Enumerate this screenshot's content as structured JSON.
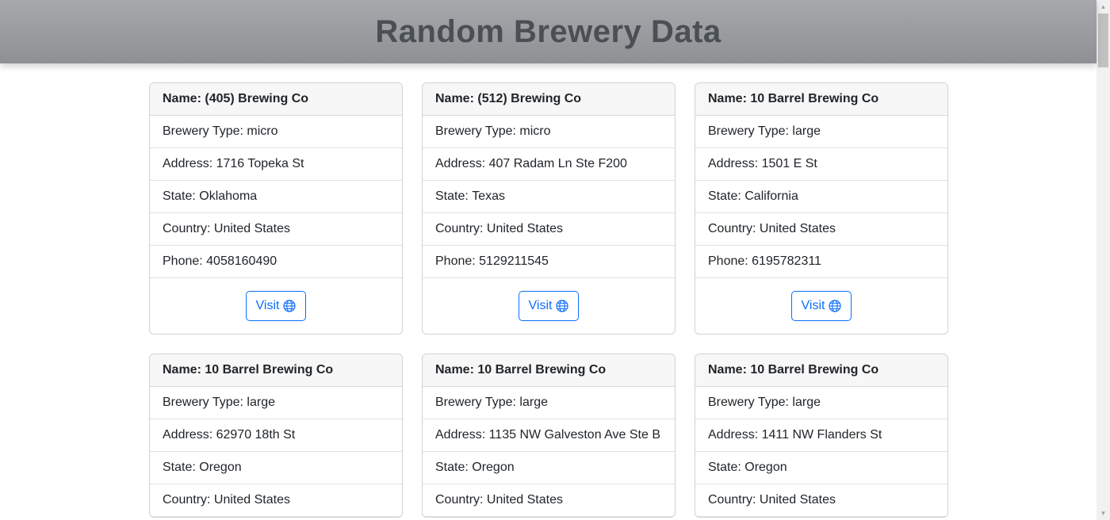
{
  "page": {
    "title": "Random Brewery Data"
  },
  "labels": {
    "name": "Name: ",
    "type": "Brewery Type: ",
    "address": "Address: ",
    "state": "State: ",
    "country": "Country: ",
    "phone": "Phone: ",
    "visit": "Visit"
  },
  "icons": {
    "visit": "globe-icon"
  },
  "colors": {
    "accent": "#0d6efd",
    "header_text": "#4a4f56"
  },
  "breweries": [
    {
      "name": "(405) Brewing Co",
      "type": "micro",
      "address": "1716 Topeka St",
      "state": "Oklahoma",
      "country": "United States",
      "phone": "4058160490"
    },
    {
      "name": "(512) Brewing Co",
      "type": "micro",
      "address": "407 Radam Ln Ste F200",
      "state": "Texas",
      "country": "United States",
      "phone": "5129211545"
    },
    {
      "name": "10 Barrel Brewing Co",
      "type": "large",
      "address": "1501 E St",
      "state": "California",
      "country": "United States",
      "phone": "6195782311"
    },
    {
      "name": "10 Barrel Brewing Co",
      "type": "large",
      "address": "62970 18th St",
      "state": "Oregon",
      "country": "United States",
      "phone": ""
    },
    {
      "name": "10 Barrel Brewing Co",
      "type": "large",
      "address": "1135 NW Galveston Ave Ste B",
      "state": "Oregon",
      "country": "United States",
      "phone": ""
    },
    {
      "name": "10 Barrel Brewing Co",
      "type": "large",
      "address": "1411 NW Flanders St",
      "state": "Oregon",
      "country": "United States",
      "phone": ""
    }
  ]
}
